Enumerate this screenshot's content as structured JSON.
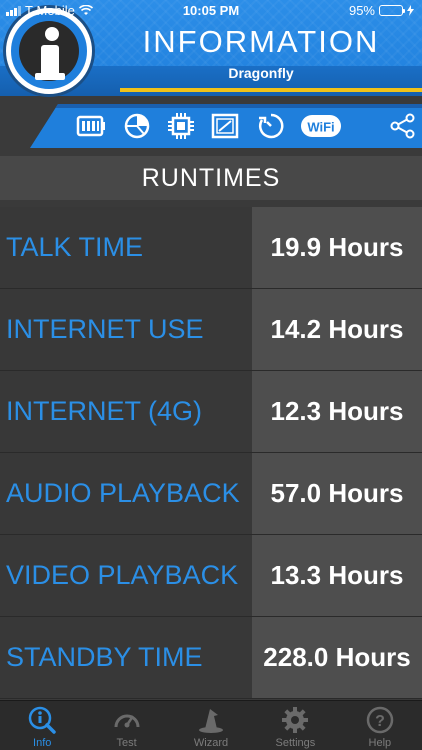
{
  "status_bar": {
    "carrier": "T-Mobile",
    "time": "10:05 PM",
    "battery_percent": "95%",
    "battery_level": 0.95
  },
  "header": {
    "title": "INFORMATION",
    "subtitle": "Dragonfly",
    "accent_color": "#1f7fdc",
    "stripe_color": "#f1c21a"
  },
  "toolbar": {
    "icons": [
      "battery-icon",
      "pie-chart-icon",
      "cpu-chip-icon",
      "display-icon",
      "timer-icon",
      "wifi-icon",
      "share-icon"
    ],
    "wifi_label": "WiFi"
  },
  "section": {
    "title": "RUNTIMES"
  },
  "runtimes": [
    {
      "label": "TALK TIME",
      "value": "19.9 Hours"
    },
    {
      "label": "INTERNET USE",
      "value": "14.2 Hours"
    },
    {
      "label": "INTERNET (4G)",
      "value": "12.3 Hours"
    },
    {
      "label": "AUDIO PLAYBACK",
      "value": "57.0 Hours"
    },
    {
      "label": "VIDEO PLAYBACK",
      "value": "13.3 Hours"
    },
    {
      "label": "STANDBY TIME",
      "value": "228.0 Hours"
    }
  ],
  "tabbar": {
    "tabs": [
      {
        "label": "Info",
        "icon": "info-search-icon",
        "active": true
      },
      {
        "label": "Test",
        "icon": "speedometer-icon",
        "active": false
      },
      {
        "label": "Wizard",
        "icon": "wizard-hat-icon",
        "active": false
      },
      {
        "label": "Settings",
        "icon": "gear-icon",
        "active": false
      },
      {
        "label": "Help",
        "icon": "help-icon",
        "active": false
      }
    ],
    "active_color": "#2b8fe6",
    "inactive_color": "#7c7c7c"
  }
}
